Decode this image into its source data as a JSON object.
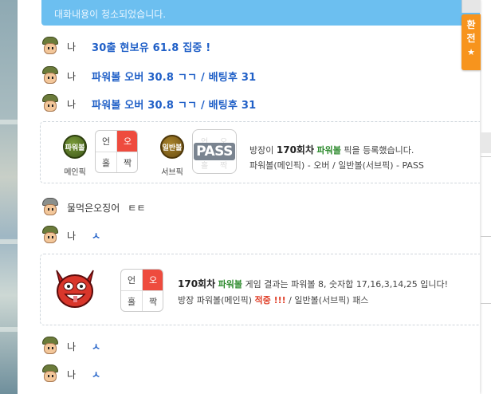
{
  "notice": "대화내용이 청소되었습니다.",
  "side_button": {
    "label_1": "환",
    "label_2": "전",
    "icon": "star-icon"
  },
  "messages": [
    {
      "nick": "나",
      "text": "30출 현보유 61.8 집중 !"
    },
    {
      "nick": "나",
      "text": "파워볼 오버 30.8 ㄱㄱ / 배팅후 31"
    },
    {
      "nick": "나",
      "text": "파워볼 오버 30.8 ㄱㄱ / 배팅후 31"
    }
  ],
  "pick_card": {
    "main_ball": "파워볼",
    "main_label": "메인픽",
    "main_grid": [
      "언",
      "오",
      "홀",
      "짝"
    ],
    "sub_ball": "일반볼",
    "sub_label": "서브픽",
    "sub_grid": [
      "언",
      "오",
      "홀",
      "짝"
    ],
    "pass": "PASS",
    "line1_pre": "방장이",
    "line1_round": "170회차",
    "line1_game": "파워볼",
    "line1_post": "픽을 등록했습니다.",
    "line2": "파워볼(메인픽) - 오버 / 일반볼(서브픽) - PASS"
  },
  "message_other": {
    "nick": "물먹은오징어",
    "text": "ㅌㅌ"
  },
  "message_4": {
    "nick": "나",
    "text": "ㅅ"
  },
  "result_card": {
    "grid": [
      "언",
      "오",
      "홀",
      "짝"
    ],
    "round": "170회차",
    "game": "파워볼",
    "line1_rest": "게임 결과는 파워볼 8, 숫자합 17,16,3,14,25 입니다!",
    "line2_pre": "방장 파워볼(메인픽)",
    "hit": "적중 !!!",
    "line2_mid": "/ 일반볼(서브픽)",
    "pass": "패스"
  },
  "message_5": {
    "nick": "나",
    "text": "ㅅ"
  },
  "message_6": {
    "nick": "나",
    "text": "ㅅ"
  },
  "colors": {
    "notice_bg": "#6cbff0",
    "side_button": "#f7941d",
    "link_blue": "#1f5fc7",
    "green": "#2e8b2e",
    "red": "#e0402a"
  }
}
